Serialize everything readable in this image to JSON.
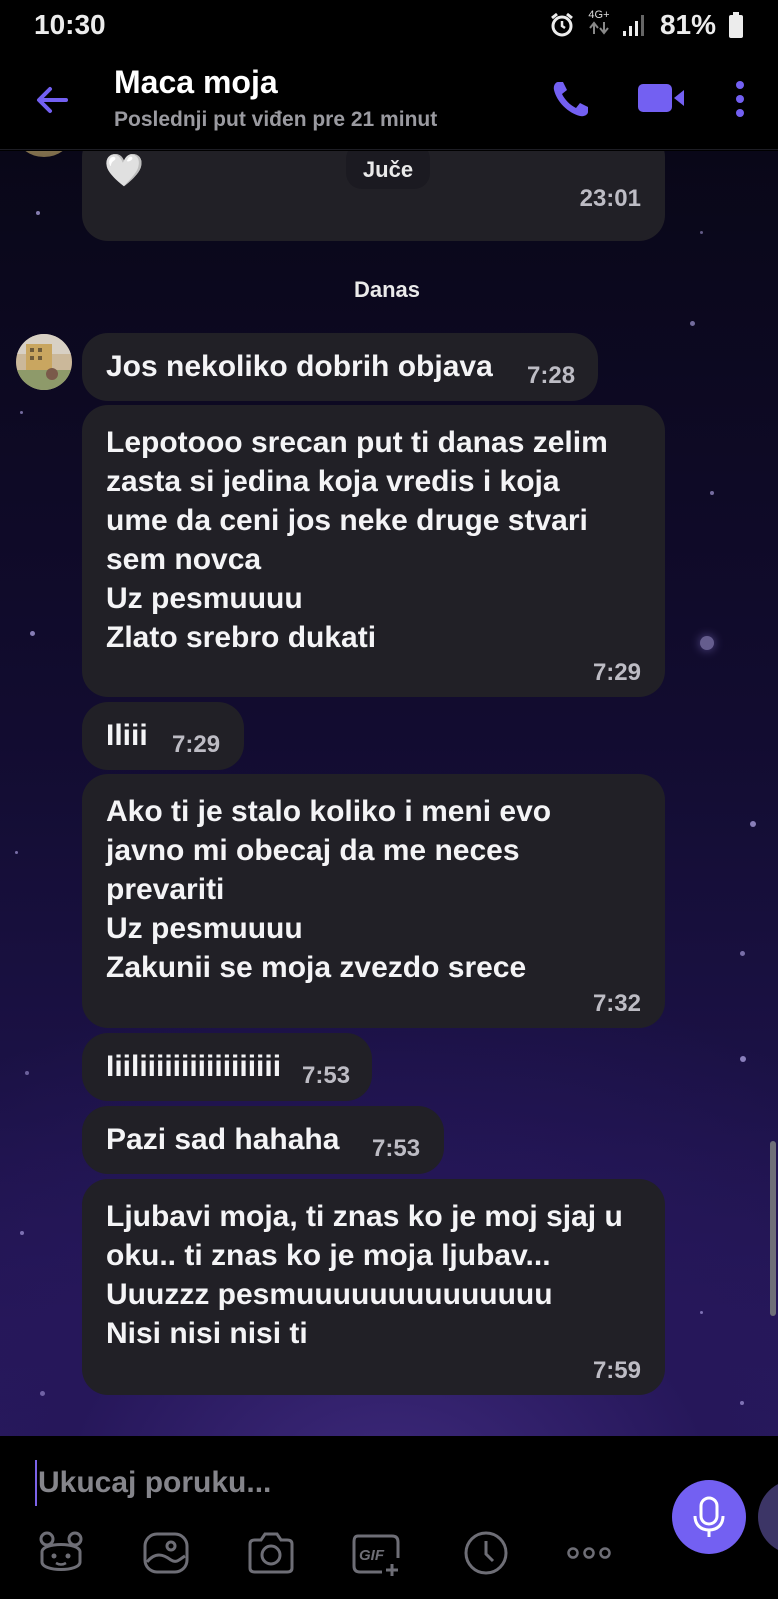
{
  "status_bar": {
    "time": "10:30",
    "network": "4G+",
    "battery": "81%"
  },
  "header": {
    "contact_name": "Maca moja",
    "last_seen": "Poslednji put viđen pre 21 minut",
    "icons": [
      "back-arrow-icon",
      "phone-icon",
      "video-camera-icon",
      "more-vertical-icon"
    ]
  },
  "chat": {
    "yesterday_label": "Juče",
    "today_label": "Danas",
    "earlier_message": {
      "emoji": "🤍",
      "time": "23:01"
    },
    "messages": [
      {
        "text": "Jos nekoliko dobrih objava",
        "time": "7:28"
      },
      {
        "text": "Lepotooo srecan put ti danas zelim\nzasta si jedina koja vredis i koja\nume da ceni jos neke druge stvari\nsem novca\nUz pesmuuuu\nZlato srebro dukati",
        "time": "7:29"
      },
      {
        "text": "Iliii",
        "time": "7:29"
      },
      {
        "text": "Ako ti je stalo koliko i meni evo\njavno mi obecaj da me neces\nprevariti\nUz pesmuuuu\nZakunii se moja zvezdo srece",
        "time": "7:32"
      },
      {
        "text": "Iiiliiiiiiiiiiiiiiiii",
        "time": "7:53"
      },
      {
        "text": "Pazi sad hahaha",
        "time": "7:53"
      },
      {
        "text": "Ljubavi moja, ti znas ko je moj sjaj u\noku.. ti znas ko je moja ljubav...\nUuuzzz pesmuuuuuuuuuuuuuu\nNisi nisi nisi ti",
        "time": "7:59"
      }
    ]
  },
  "input": {
    "placeholder": "Ukucaj poruku...",
    "toolbar": [
      "sticker-bear-icon",
      "gallery-icon",
      "camera-icon",
      "gif-icon",
      "clock-icon",
      "more-horizontal-icon",
      "microphone-icon"
    ]
  },
  "colors": {
    "accent": "#7360f2",
    "bubble": "#212026",
    "background_top": "#090718",
    "background_bottom": "#2a1a62"
  }
}
